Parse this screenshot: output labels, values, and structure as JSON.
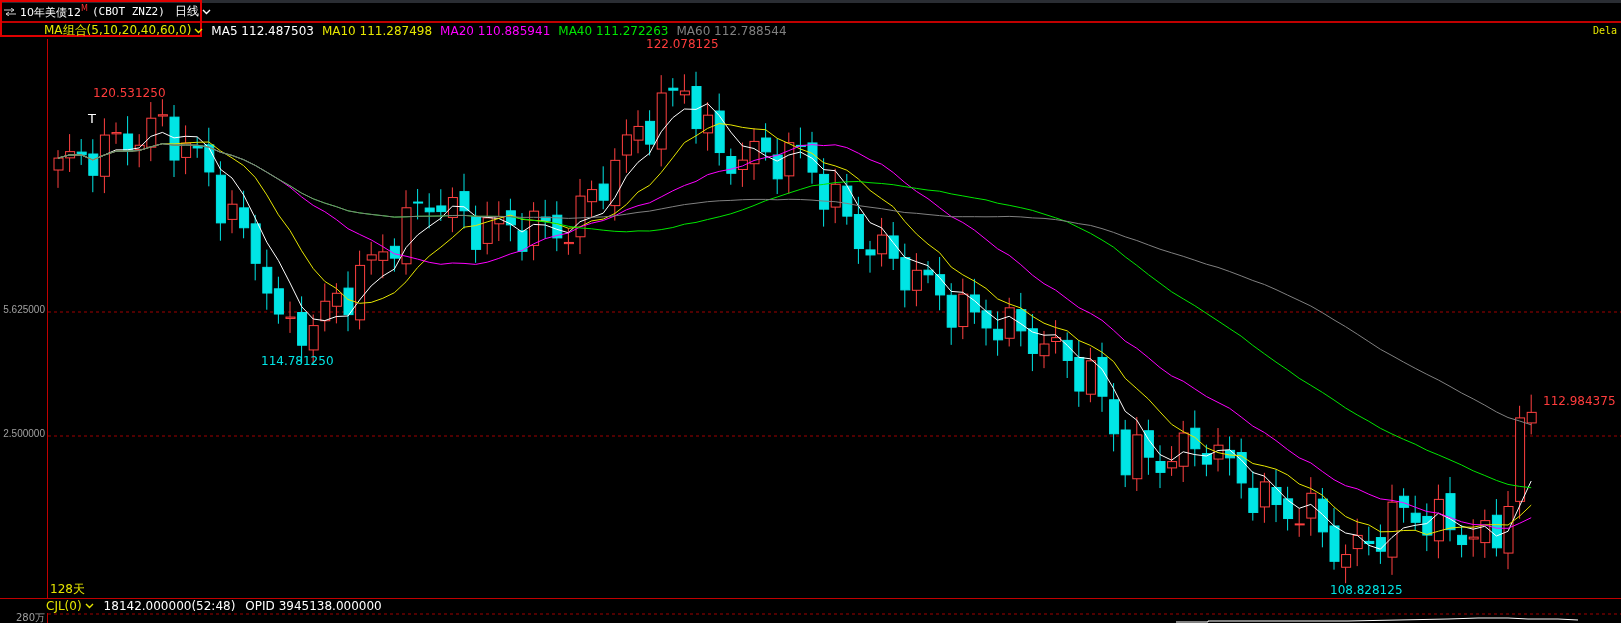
{
  "header": {
    "title": "10年美债12$^{M}$",
    "contract": "(CBOT ZNZ2)",
    "period": "日线"
  },
  "ma_legend": {
    "selector": "MA组合(5,10,20,40,60,0)",
    "items": [
      {
        "label": "MA5",
        "value": "112.487503",
        "color": "#ffffff"
      },
      {
        "label": "MA10",
        "value": "111.287498",
        "color": "#e6e600"
      },
      {
        "label": "MA20",
        "value": "110.885941",
        "color": "#ff00ff"
      },
      {
        "label": "MA40",
        "value": "111.272263",
        "color": "#00e600"
      },
      {
        "label": "MA60",
        "value": "112.788544",
        "color": "#808080"
      }
    ]
  },
  "corner_text": "Dela",
  "price_axis": [
    "5.625000",
    "2.500000"
  ],
  "price_labels": [
    {
      "text": "120.531250",
      "kind": "high"
    },
    {
      "text": "122.078125",
      "kind": "high"
    },
    {
      "text": "114.781250",
      "kind": "low"
    },
    {
      "text": "108.828125",
      "kind": "low"
    },
    {
      "text": "112.984375",
      "kind": "high"
    }
  ],
  "marker": "T",
  "span_label": "128天",
  "indicator": {
    "selector": "CJL(0)",
    "volume": "18142.000000(52:48)",
    "open_interest_label": "OPID",
    "open_interest": "3945138.000000",
    "axis_label": "280万"
  }
}
